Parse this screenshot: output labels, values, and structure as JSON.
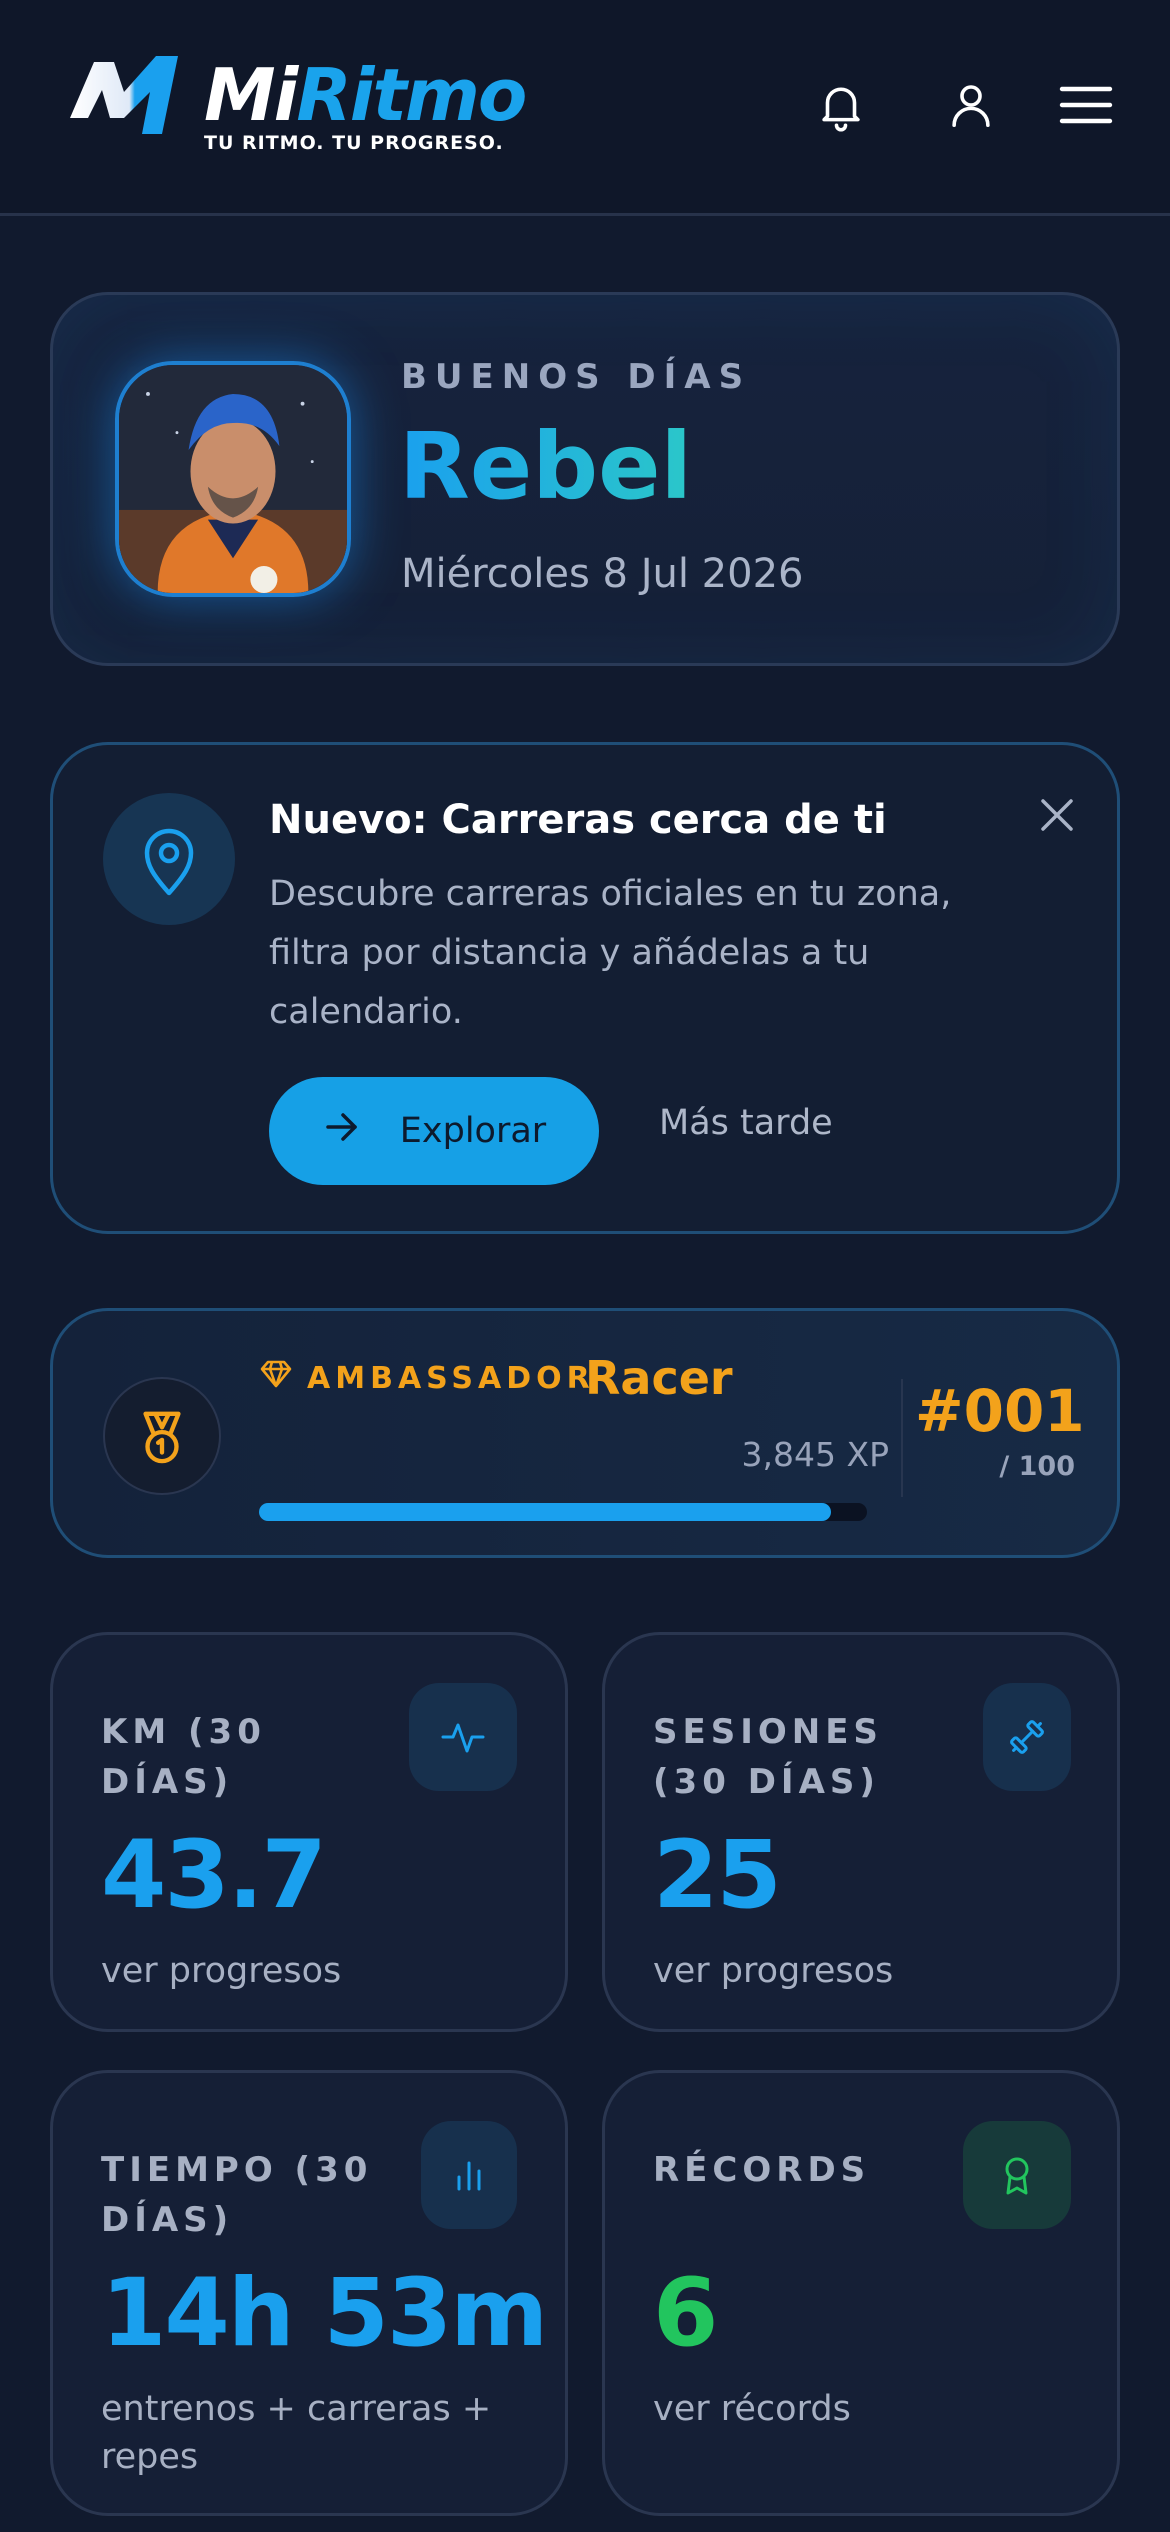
{
  "header": {
    "logo_primary": "Mi",
    "logo_accent": "Ritmo",
    "tagline": "TU RITMO. TU PROGRESO.",
    "icons": [
      "bell-icon",
      "user-icon",
      "menu-icon"
    ]
  },
  "greeting": {
    "label": "BUENOS DÍAS",
    "name": "Rebel",
    "date": "Miércoles 8 Jul 2026"
  },
  "promo": {
    "title": "Nuevo: Carreras cerca de ti",
    "description": "Descubre carreras oficiales en tu zona, filtra por distancia y añádelas a tu calendario.",
    "primary_label": "Explorar",
    "secondary_label": "Más tarde"
  },
  "ambassador": {
    "label": "AMBASSADOR",
    "rank": "Racer",
    "xp": "3,845 XP",
    "progress": 0.94,
    "number": "#001",
    "total": "/ 100"
  },
  "stats": [
    {
      "label": "KM (30 DÍAS)",
      "value": "43.7",
      "sub": "ver progresos",
      "icon": "activity-icon"
    },
    {
      "label": "SESIONES (30 DÍAS)",
      "value": "25",
      "sub": "ver progresos",
      "icon": "dumbbell-icon"
    },
    {
      "label": "TIEMPO (30 DÍAS)",
      "value": "14h 53m",
      "sub": "entrenos + carreras + repes",
      "icon": "bar-chart-icon"
    },
    {
      "label": "RÉCORDS",
      "value": "6",
      "sub": "ver récords",
      "icon": "award-icon"
    }
  ],
  "colors": {
    "accent": "#1aa0ee",
    "gold": "#f3a21b",
    "green": "#22c55e",
    "background": "#111a2e"
  }
}
